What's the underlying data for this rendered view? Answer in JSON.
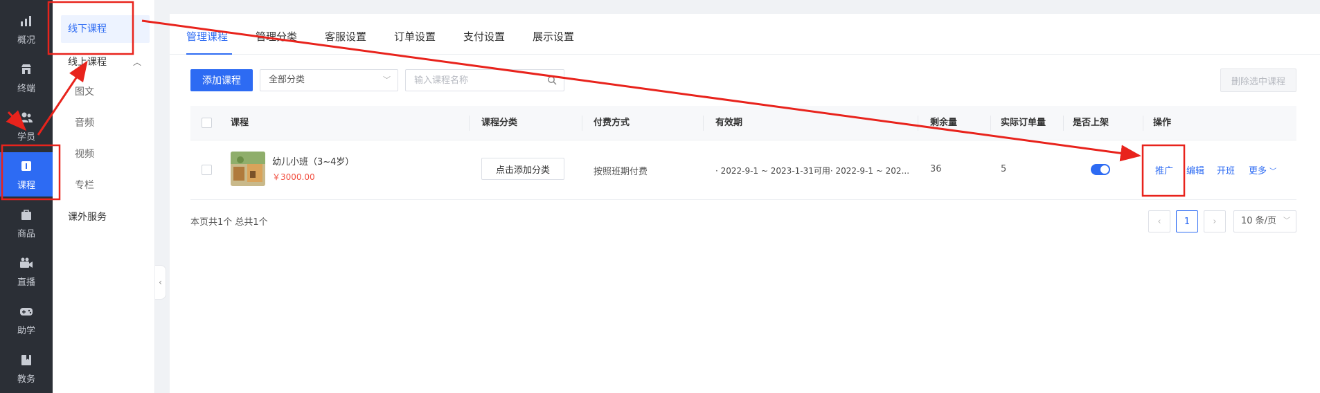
{
  "nav": {
    "items": [
      {
        "label": "概况",
        "icon": "chart-icon"
      },
      {
        "label": "终端",
        "icon": "store-icon"
      },
      {
        "label": "学员",
        "icon": "users-icon"
      },
      {
        "label": "课程",
        "icon": "book-icon"
      },
      {
        "label": "商品",
        "icon": "bag-icon"
      },
      {
        "label": "直播",
        "icon": "camera-icon"
      },
      {
        "label": "助学",
        "icon": "gamepad-icon"
      },
      {
        "label": "教务",
        "icon": "bookmark-icon"
      }
    ],
    "active": "课程"
  },
  "subnav": {
    "offline": "线下课程",
    "online": "线上课程",
    "online_children": [
      "图文",
      "音频",
      "视频",
      "专栏"
    ],
    "extra": "课外服务"
  },
  "tabs": [
    "管理课程",
    "管理分类",
    "客服设置",
    "订单设置",
    "支付设置",
    "展示设置"
  ],
  "toolbar": {
    "add_label": "添加课程",
    "category_select": "全部分类",
    "search_placeholder": "输入课程名称",
    "delete_label": "删除选中课程"
  },
  "table": {
    "headers": [
      "课程",
      "课程分类",
      "付费方式",
      "有效期",
      "剩余量",
      "实际订单量",
      "是否上架",
      "操作"
    ],
    "row": {
      "name": "幼儿小班（3~4岁）",
      "price": "￥3000.00",
      "category_button": "点击添加分类",
      "payment": "按照班期付费",
      "validity": "· 2022-9-1 ~ 2023-1-31可用· 2022-9-1 ~ 202...",
      "remaining": "36",
      "orders": "5",
      "listed": true,
      "actions": {
        "promote": "推广",
        "edit": "编辑",
        "open_class": "开班",
        "more": "更多"
      }
    }
  },
  "pagination": {
    "summary": "本页共1个 总共1个",
    "current_page": "1",
    "page_size": "10 条/页"
  },
  "colors": {
    "accent": "#2d6bf3",
    "annotation": "#e8231c",
    "nav_bg": "#2b2f36",
    "price": "#f24e3f"
  }
}
